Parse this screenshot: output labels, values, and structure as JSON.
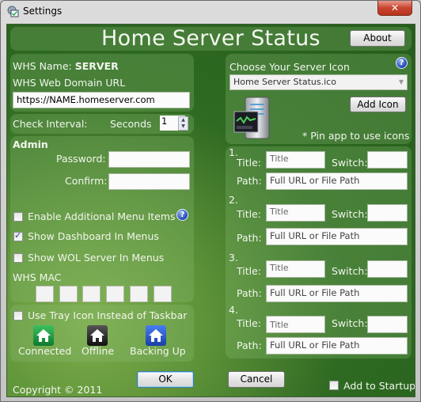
{
  "window": {
    "title": "Settings",
    "close_icon": "close-x-icon"
  },
  "header": {
    "app_title": "Home Server Status",
    "about_label": "About"
  },
  "server": {
    "name_label": "WHS Name:",
    "name_value": "SERVER",
    "domain_label": "WHS Web Domain URL",
    "domain_value": "https://NAME.homeserver.com"
  },
  "interval": {
    "label": "Check Interval:",
    "unit": "Seconds",
    "value": "1"
  },
  "admin": {
    "heading": "Admin",
    "password_label": "Password:",
    "password_value": "",
    "confirm_label": "Confirm:",
    "confirm_value": ""
  },
  "options": {
    "enable_menu_items": {
      "label": "Enable Additional Menu Items",
      "checked": false
    },
    "show_dashboard": {
      "label": "Show Dashboard In Menus",
      "checked": true
    },
    "show_wol": {
      "label": "Show WOL Server In Menus",
      "checked": false
    },
    "help_icon": "?"
  },
  "mac": {
    "label": "WHS MAC",
    "octets": [
      "",
      "",
      "",
      "",
      "",
      ""
    ]
  },
  "tray": {
    "label": "Use Tray Icon Instead of Taskbar",
    "checked": false,
    "states": [
      {
        "label": "Connected",
        "icon": "house-green-icon",
        "color": "#1f9a3a"
      },
      {
        "label": "Offline",
        "icon": "house-black-icon",
        "color": "#2a2a2a"
      },
      {
        "label": "Backing Up",
        "icon": "house-blue-icon",
        "color": "#2456c8"
      }
    ]
  },
  "icon_chooser": {
    "heading": "Choose Your Server Icon",
    "selected": "Home Server Status.ico",
    "add_label": "Add Icon",
    "pin_note": "* Pin app to use icons",
    "help_icon": "?"
  },
  "shortcuts": {
    "title_label": "Title:",
    "switch_label": "Switch:",
    "path_label": "Path:",
    "title_placeholder": "Title",
    "path_placeholder": "Full URL or File Path",
    "items": [
      {
        "number": "1.",
        "title": "",
        "switch": "",
        "path": ""
      },
      {
        "number": "2.",
        "title": "",
        "switch": "",
        "path": ""
      },
      {
        "number": "3.",
        "title": "",
        "switch": "",
        "path": ""
      },
      {
        "number": "4.",
        "title": "",
        "switch": "",
        "path": ""
      }
    ]
  },
  "footer": {
    "copyright": "Copyright © 2011",
    "ok_label": "OK",
    "cancel_label": "Cancel",
    "startup_label": "Add to Startup",
    "startup_checked": false
  }
}
